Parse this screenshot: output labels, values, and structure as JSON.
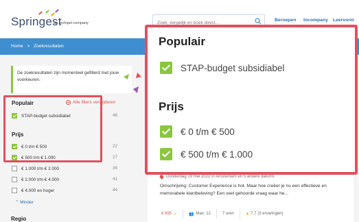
{
  "header": {
    "logo_text": "Springest",
    "logo_sub": "an  archipel company",
    "search_placeholder": "Zoek, vergelijk en boek direct...",
    "nav": [
      "Beroepen",
      "Incompany",
      "Leervorm"
    ]
  },
  "breadcrumb": {
    "home": "Home",
    "separator": ">",
    "current": "Zoekresultaten"
  },
  "notice": {
    "text": "De zoekresultaten zijn momenteel gefilterd met jouw voorkeuren."
  },
  "filters": {
    "popular_title": "Populair",
    "clear_label": "Alle filters verwijderen",
    "popular_items": [
      {
        "label": "STAP-budget subsidiabel",
        "count": "48",
        "checked": true
      }
    ],
    "price_title": "Prijs",
    "price_items": [
      {
        "label": "€ 0 t/m € 500",
        "count": "22",
        "checked": true
      },
      {
        "label": "€ 500 t/m € 1.000",
        "count": "27",
        "checked": true
      },
      {
        "label": "€ 1.000 t/m € 2.000",
        "count": "36",
        "checked": false
      },
      {
        "label": "€ 2.000 t/m € 4.000",
        "count": "41",
        "checked": false
      },
      {
        "label": "€ 4.000 en hoger",
        "count": "44",
        "checked": false
      }
    ],
    "less_label": "Minder",
    "region_title": "Regio"
  },
  "zoom": {
    "popular_title": "Populair",
    "popular_item": "STAP-budget subsidiabel",
    "price_title": "Prijs",
    "price_items": [
      "€ 0 t/m € 500",
      "€ 500 t/m € 1.000"
    ]
  },
  "card": {
    "meta": "Donderdag 19 mei 2022 in Amsterdam en 5 andere datums",
    "description": "Omschrijving: Customer Experience is hot. Maar hoe creëer je nu een effectieve en memorabele klantbeleving? Een veel gehoorde vraag waar he...",
    "price": "€ 695",
    "max": "Max: 12",
    "hours": "7 uren",
    "rating": "7,7 (3 ervaringen)"
  },
  "colors": {
    "accent_green": "#8cc63f",
    "highlight_red": "#e0505e",
    "brand_blue": "#3f8fd0"
  }
}
